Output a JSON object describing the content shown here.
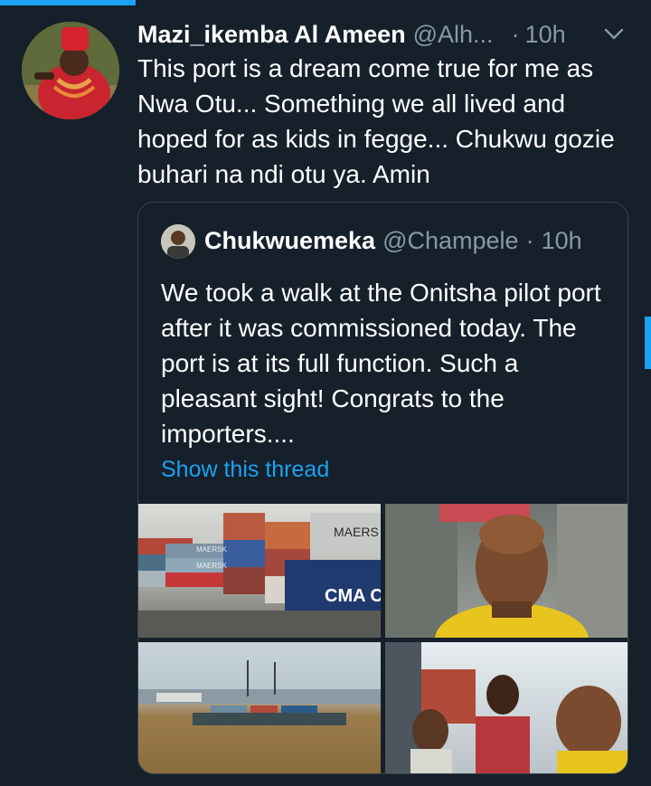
{
  "tweet": {
    "author_name": "Mazi_ikemba Al Ameen",
    "author_handle": "@Alh...",
    "separator": "·",
    "time": "10h",
    "text": "This port is a dream come true for me as Nwa Otu... Something we all lived and hoped for as kids in fegge... Chukwu gozie buhari na ndi otu ya. Amin"
  },
  "quoted_tweet": {
    "author_name": "Chukwuemeka",
    "author_handle": "@Champele",
    "separator": "·",
    "time": "10h",
    "text": "We took a walk at the Onitsha pilot port after it was commissioned today. The port is at its full function. Such a pleasant sight! Congrats to the importers....",
    "link_label": "Show this thread"
  },
  "media": {
    "photo1_labels": [
      "MAERSK",
      "MAERSK",
      "MAERS",
      "CMA C"
    ]
  },
  "colors": {
    "background": "#15202b",
    "border": "#38444d",
    "secondary_text": "#8899a6",
    "accent": "#1da1f2"
  }
}
